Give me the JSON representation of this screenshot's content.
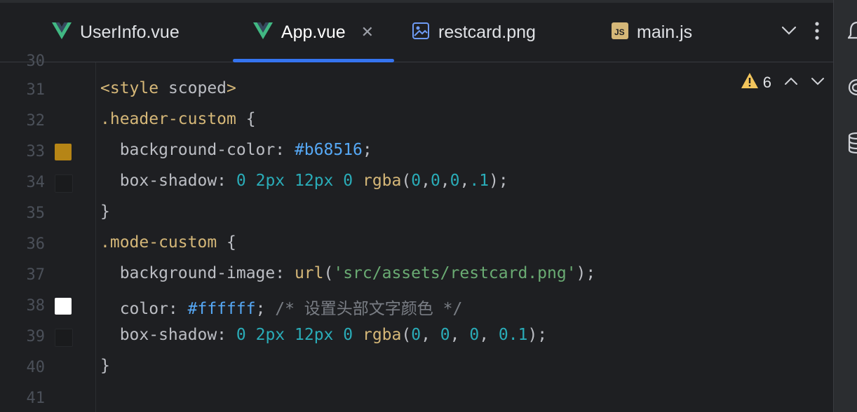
{
  "tabs": [
    {
      "label": "UserInfo.vue",
      "icon": "vue-icon",
      "active": false
    },
    {
      "label": "App.vue",
      "icon": "vue-icon",
      "active": true
    },
    {
      "label": "restcard.png",
      "icon": "image-file-icon",
      "active": false
    },
    {
      "label": "main.js",
      "icon": "js-file-icon",
      "active": false,
      "icon_text": "JS"
    }
  ],
  "inspection": {
    "warnings": "6"
  },
  "line_numbers": [
    "31",
    "32",
    "33",
    "34",
    "35",
    "36",
    "37",
    "38",
    "39",
    "40",
    "41"
  ],
  "swatches": {
    "line33": "#b68516",
    "line34": "rgba(0,0,0,.1)",
    "line38": "#ffffff",
    "line39": "rgba(0, 0, 0, 0.1)"
  },
  "code": {
    "l31": {
      "tag_open": "<style",
      "attr": " scoped",
      "tag_close": ">"
    },
    "l32": {
      "selector": ".header-custom",
      "brace": " {"
    },
    "l33": {
      "prop": "  background-color: ",
      "value": "#b68516",
      "end": ";"
    },
    "l34": {
      "prop": "  box-shadow: ",
      "n1": "0",
      "n2": "2px",
      "n3": "12px",
      "n4": "0",
      "fn": "rgba",
      "open": "(",
      "a1": "0",
      "c1": ",",
      "a2": "0",
      "c2": ",",
      "a3": "0",
      "c3": ",",
      "a4": ".1",
      "end": ");"
    },
    "l35": {
      "text": "}"
    },
    "l36": {
      "selector": ".mode-custom",
      "brace": " {"
    },
    "l37": {
      "prop": "  background-image: ",
      "fn": "url",
      "open": "(",
      "str": "'src/assets/restcard.png'",
      "end": ");"
    },
    "l38": {
      "prop": "  color: ",
      "value": "#ffffff",
      "semi": ";",
      "comment": " /* 设置头部文字颜色 */"
    },
    "l39": {
      "prop": "  box-shadow: ",
      "n1": "0",
      "n2": "2px",
      "n3": "12px",
      "n4": "0",
      "fn": "rgba",
      "open": "(",
      "a1": "0",
      "c1": ", ",
      "a2": "0",
      "c2": ", ",
      "a3": "0",
      "c3": ", ",
      "a4": "0.1",
      "end": ");"
    },
    "l40": {
      "text": "}"
    }
  },
  "colors": {
    "accent": "#3574f0",
    "background": "#1e1f22",
    "vue_green": "#41b883",
    "js_badge": "#d5b778",
    "warning": "#f2c55c"
  }
}
